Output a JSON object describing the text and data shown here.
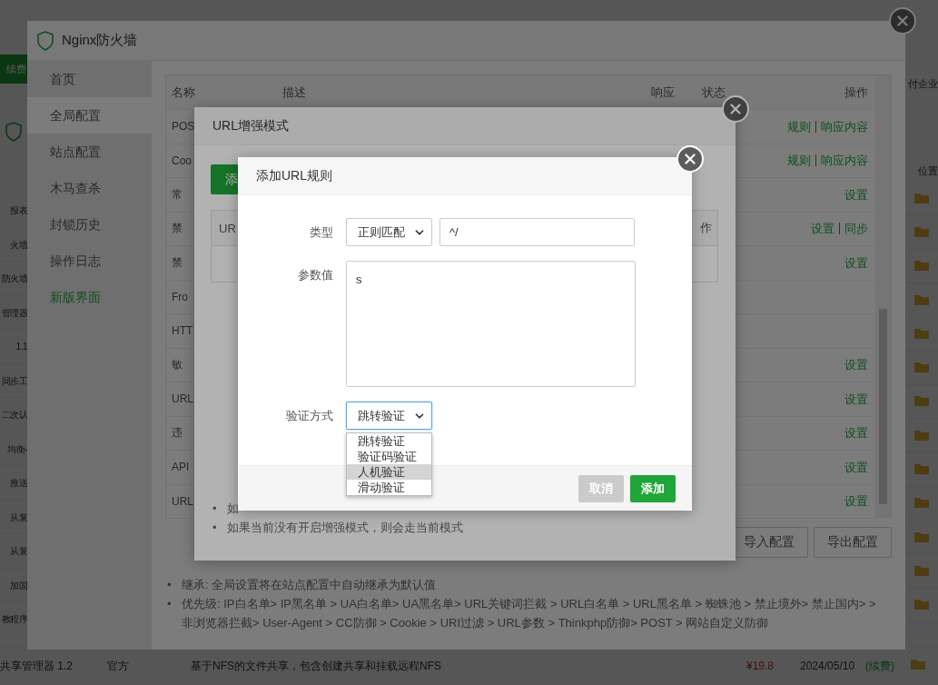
{
  "background_page": {
    "left_items": [
      {
        "kind": "button",
        "label": "续费"
      },
      {
        "kind": "logo"
      },
      {
        "kind": "text",
        "label": "报表"
      },
      {
        "kind": "text",
        "label": "火墙"
      },
      {
        "kind": "text",
        "label": "防火墙"
      },
      {
        "kind": "text",
        "label": "管理器"
      },
      {
        "kind": "text",
        "label": "1.1"
      },
      {
        "kind": "text",
        "label": "同步工"
      },
      {
        "kind": "text",
        "label": "二次认"
      },
      {
        "kind": "text",
        "label": "均衡-"
      },
      {
        "kind": "text",
        "label": "推送"
      },
      {
        "kind": "text",
        "label": "从复"
      },
      {
        "kind": "text",
        "label": "从复"
      },
      {
        "kind": "text",
        "label": "加固"
      },
      {
        "kind": "text",
        "label": "教程序"
      }
    ],
    "right_items": [
      {
        "kind": "text",
        "label": "付企业"
      },
      {
        "kind": "text",
        "label": "位置"
      },
      {
        "kind": "folder"
      },
      {
        "kind": "folder"
      },
      {
        "kind": "folder"
      },
      {
        "kind": "folder"
      },
      {
        "kind": "folder"
      },
      {
        "kind": "folder"
      },
      {
        "kind": "folder"
      },
      {
        "kind": "folder"
      },
      {
        "kind": "folder"
      },
      {
        "kind": "folder"
      },
      {
        "kind": "folder"
      },
      {
        "kind": "folder"
      },
      {
        "kind": "folder"
      }
    ],
    "bottom_row": {
      "name": "共享管理器 1.2",
      "source": "官方",
      "description": "基于NFS的文件共享，包含创建共享和挂载远程NFS",
      "price": "¥19.8",
      "expiry": "2024/05/10",
      "renew": "(续费)"
    }
  },
  "window": {
    "title": "Nginx防火墙",
    "sidebar": {
      "items": [
        {
          "label": "首页",
          "selected": false,
          "accent": false
        },
        {
          "label": "全局配置",
          "selected": true,
          "accent": false
        },
        {
          "label": "站点配置",
          "selected": false,
          "accent": false
        },
        {
          "label": "木马查杀",
          "selected": false,
          "accent": false
        },
        {
          "label": "封锁历史",
          "selected": false,
          "accent": false
        },
        {
          "label": "操作日志",
          "selected": false,
          "accent": false
        },
        {
          "label": "新版界面",
          "selected": false,
          "accent": true
        }
      ]
    },
    "table": {
      "columns": [
        "名称",
        "描述",
        "响应",
        "状态",
        "操作"
      ],
      "rows": [
        {
          "name": "POS",
          "actions": [
            "规则",
            "响应内容"
          ]
        },
        {
          "name": "Coo",
          "actions": [
            "规则",
            "响应内容"
          ]
        },
        {
          "name": "常",
          "actions": [
            "设置"
          ]
        },
        {
          "name": "禁",
          "actions": [
            "设置",
            "同步"
          ]
        },
        {
          "name": "禁",
          "actions": [
            "设置"
          ]
        },
        {
          "name": "Fro"
        },
        {
          "name": "HTT"
        },
        {
          "name": "敏",
          "actions": [
            "设置"
          ]
        },
        {
          "name": "URL",
          "actions": [
            "设置"
          ]
        },
        {
          "name": "违",
          "actions": [
            "设置"
          ]
        },
        {
          "name": "API",
          "actions": [
            "设置"
          ]
        },
        {
          "name": "URL",
          "actions": [
            "设置"
          ]
        }
      ]
    },
    "buttons": [
      "导入配置",
      "导出配置"
    ],
    "notes": [
      {
        "bullet": "•",
        "text": "继承: 全局设置将在站点配置中自动继承为默认值"
      },
      {
        "bullet": "•",
        "text": "优先级: IP白名单> IP黑名单 > UA白名单> UA黑名单> URL关键词拦截 > URL白名单 > URL黑名单 > 蜘蛛池 > 禁止境外> 禁止国内> > 非浏览器拦截> User-Agent > CC防御 > Cookie > URI过滤 > URL参数 > Thinkphp防御> POST > 网站自定义防御"
      }
    ]
  },
  "url_dialog": {
    "title": "URL增强模式",
    "add_button": "添",
    "table": {
      "columns": [
        "UR",
        "作"
      ]
    },
    "notes": [
      {
        "bullet": "•",
        "text": "如"
      },
      {
        "bullet": "•",
        "text": "如果当前没有开启增强模式，则会走当前模式"
      }
    ]
  },
  "add_dialog": {
    "title": "添加URL规则",
    "fields": [
      {
        "label": "类型",
        "select": "正则匹配",
        "value": "^/"
      },
      {
        "label": "参数值",
        "value": "s"
      },
      {
        "label": "验证方式",
        "select": "跳转验证",
        "focused": true,
        "options": [
          {
            "label": "跳转验证",
            "highlighted": false
          },
          {
            "label": "验证码验证",
            "highlighted": false
          },
          {
            "label": "人机验证",
            "highlighted": true
          },
          {
            "label": "滑动验证",
            "highlighted": false
          }
        ]
      }
    ],
    "buttons": [
      {
        "label": "取消",
        "kind": "secondary"
      },
      {
        "label": "添加",
        "kind": "primary"
      }
    ]
  }
}
